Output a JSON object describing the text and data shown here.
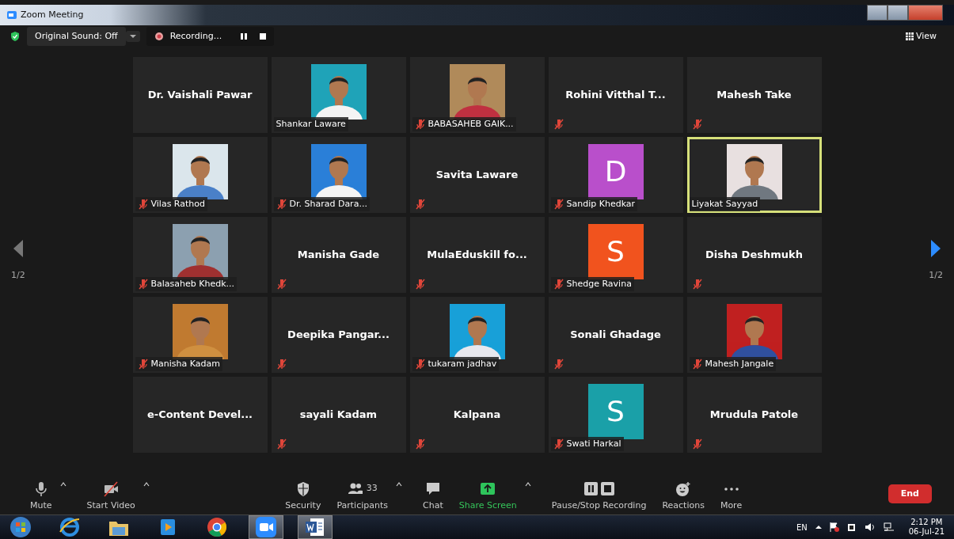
{
  "window": {
    "title": "Zoom Meeting"
  },
  "top_bar": {
    "original_sound": "Original Sound: Off",
    "recording": "Recording...",
    "view": "View"
  },
  "pager": {
    "left": "1/2",
    "right": "1/2"
  },
  "tiles": [
    {
      "kind": "name",
      "name": "Dr. Vaishali Pawar",
      "muted": false,
      "speaking": false
    },
    {
      "name": "Shankar Laware",
      "muted": false,
      "speaking": false
    },
    {
      "name": "BABASAHEB GAIK...",
      "muted": true,
      "speaking": false
    },
    {
      "kind": "name",
      "name": "Rohini  Vitthal  T...",
      "muted": true,
      "speaking": false
    },
    {
      "kind": "name",
      "name": "Mahesh Take",
      "muted": true,
      "speaking": false
    },
    {
      "name": "Vilas Rathod",
      "muted": true,
      "speaking": false
    },
    {
      "name": "Dr. Sharad Dara...",
      "muted": true,
      "speaking": false
    },
    {
      "kind": "name",
      "name": "Savita Laware",
      "muted": true,
      "speaking": false
    },
    {
      "kind": "letter",
      "name": "Sandip Khedkar",
      "letter": "D",
      "color": "#b94fcb",
      "muted": true,
      "speaking": false
    },
    {
      "name": "Liyakat Sayyad",
      "muted": false,
      "speaking": true
    },
    {
      "name": "Balasaheb Khedk...",
      "muted": true,
      "speaking": false
    },
    {
      "kind": "name",
      "name": "Manisha Gade",
      "muted": true,
      "speaking": false
    },
    {
      "kind": "name",
      "name": "MulaEduskill  fo...",
      "muted": true,
      "speaking": false
    },
    {
      "kind": "letter",
      "name": "Shedge Ravina",
      "letter": "S",
      "color": "#f1531e",
      "muted": true,
      "speaking": false
    },
    {
      "kind": "name",
      "name": "Disha Deshmukh",
      "muted": true,
      "speaking": false
    },
    {
      "name": "Manisha Kadam",
      "muted": true,
      "speaking": false
    },
    {
      "kind": "name",
      "name": "Deepika  Pangar...",
      "muted": true,
      "speaking": false
    },
    {
      "name": "tukaram jadhav",
      "muted": true,
      "speaking": false
    },
    {
      "kind": "name",
      "name": "Sonali Ghadage",
      "muted": true,
      "speaking": false
    },
    {
      "name": "Mahesh Jangale",
      "muted": true,
      "speaking": false
    },
    {
      "kind": "name",
      "name": "e-Content  Devel...",
      "muted": false,
      "speaking": false
    },
    {
      "kind": "name",
      "name": "sayali Kadam",
      "muted": true,
      "speaking": false
    },
    {
      "kind": "name",
      "name": "Kalpana",
      "muted": true,
      "speaking": false
    },
    {
      "kind": "letter",
      "name": "Swati Harkal",
      "letter": "S",
      "color": "#1aa0a8",
      "muted": true,
      "speaking": false
    },
    {
      "kind": "name",
      "name": "Mrudula Patole",
      "muted": true,
      "speaking": false
    }
  ],
  "toolbar": [
    {
      "kind": "mic",
      "label": "Mute",
      "has_menu": true
    },
    {
      "kind": "video",
      "label": "Start Video",
      "has_menu": true
    },
    {
      "kind": "gap"
    },
    {
      "kind": "security",
      "label": "Security",
      "has_menu": false
    },
    {
      "kind": "participants",
      "label": "Participants",
      "count": "33",
      "has_menu": true
    },
    {
      "kind": "chat",
      "label": "Chat",
      "has_menu": false
    },
    {
      "kind": "share",
      "label": "Share Screen",
      "has_menu": true
    },
    {
      "kind": "record",
      "label": "Pause/Stop Recording",
      "has_menu": false
    },
    {
      "kind": "reactions",
      "label": "Reactions",
      "has_menu": false
    },
    {
      "kind": "more",
      "label": "More",
      "has_menu": false
    }
  ],
  "end_button": "End",
  "taskbar": {
    "apps": [
      {
        "kind": "start",
        "active": false
      },
      {
        "kind": "browser-e",
        "active": false
      },
      {
        "kind": "folder",
        "active": false
      },
      {
        "kind": "player",
        "active": false
      },
      {
        "kind": "chrome",
        "active": false
      },
      {
        "kind": "zoom",
        "active": true
      },
      {
        "kind": "word",
        "active": true
      }
    ],
    "language": "EN",
    "time": "2:12 PM",
    "date": "06-Jul-21"
  }
}
